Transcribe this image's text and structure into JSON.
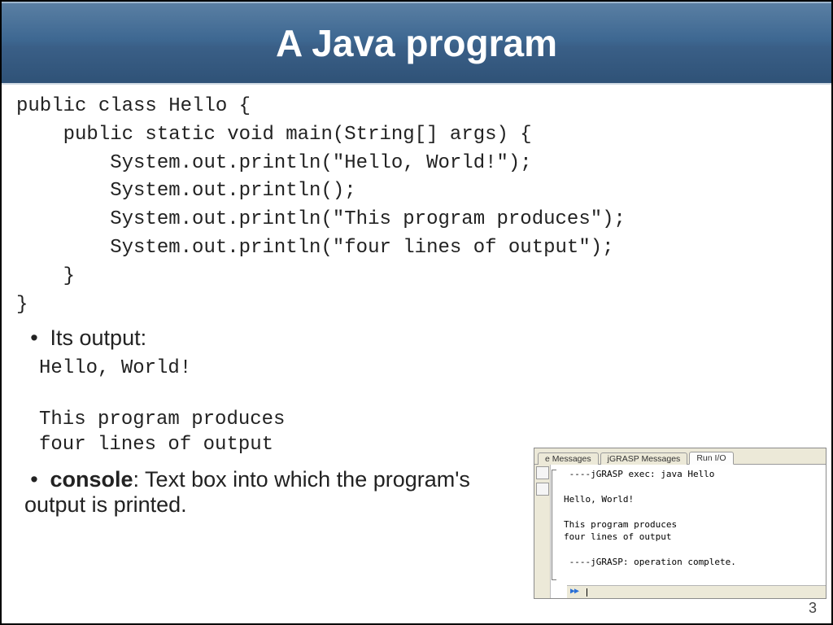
{
  "title": "A Java program",
  "code": "public class Hello {\n    public static void main(String[] args) {\n        System.out.println(\"Hello, World!\");\n        System.out.println();\n        System.out.println(\"This program produces\");\n        System.out.println(\"four lines of output\");\n    }\n}",
  "bullet_output_label": "Its output:",
  "output": "Hello, World!\n\nThis program produces\nfour lines of output",
  "bullet_console_prefix": "console",
  "bullet_console_rest": ": Text box into which the program's output is printed.",
  "page_number": "3",
  "jgrasp": {
    "tabs": [
      "e Messages",
      "jGRASP Messages",
      "Run I/O"
    ],
    "active_tab_index": 2,
    "console_text": " ----jGRASP exec: java Hello\n\nHello, World!\n\nThis program produces\nfour lines of output\n\n ----jGRASP: operation complete.",
    "play_glyph": "▶▶"
  }
}
